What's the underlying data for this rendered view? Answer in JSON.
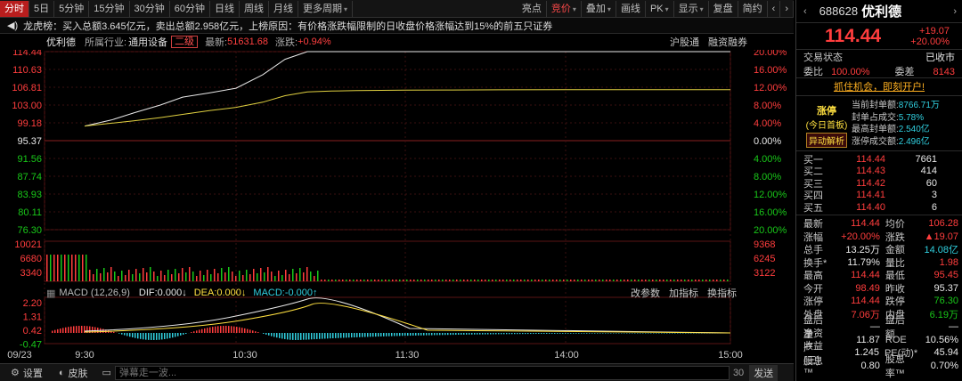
{
  "toolbar": {
    "left_tabs": [
      "分时",
      "5日",
      "5分钟",
      "15分钟",
      "30分钟",
      "60分钟",
      "日线",
      "周线",
      "月线",
      "更多周期"
    ],
    "right_buttons": [
      "亮点",
      "竞价",
      "叠加",
      "画线",
      "PK",
      "显示",
      "复盘",
      "简约"
    ],
    "active_tab": "分时",
    "active_right": "竞价"
  },
  "ticker": {
    "prefix": "龙虎榜：",
    "text": "买入总额3.645亿元，卖出总额2.958亿元，上榜原因：有价格涨跌幅限制的日收盘价格涨幅达到15%的前五只证券"
  },
  "info": {
    "name": "优利德",
    "industry_label": "所属行业:",
    "industry": "通用设备",
    "board": "二级",
    "latest_label": "最新:",
    "latest": "51631.68",
    "change_label": "涨跌:",
    "change": "+0.94%",
    "link1": "沪股通",
    "link2": "融资融券"
  },
  "price_axis": {
    "left": [
      "114.44",
      "110.63",
      "106.81",
      "103.00",
      "99.18",
      "95.37",
      "91.56",
      "87.74",
      "83.93",
      "80.11",
      "76.30"
    ],
    "right": [
      "20.00%",
      "16.00%",
      "12.00%",
      "8.00%",
      "4.00%",
      "0.00%",
      "4.00%",
      "8.00%",
      "12.00%",
      "16.00%",
      "20.00%"
    ]
  },
  "volume_axis": {
    "left": [
      "10021",
      "6680",
      "3340"
    ],
    "right": [
      "9368",
      "6245",
      "3122"
    ]
  },
  "macd": {
    "title": "MACD (12,26,9)",
    "dif": "DIF:0.000",
    "dea": "DEA:0.000",
    "macd": "MACD:-0.000",
    "buttons": [
      "改参数",
      "加指标",
      "换指标"
    ],
    "axis": [
      "2.20",
      "1.31",
      "0.42",
      "-0.47"
    ]
  },
  "time_axis": [
    "09/23",
    "9:30",
    "10:30",
    "11:30",
    "14:00",
    "15:00"
  ],
  "bottom": {
    "settings": "设置",
    "skin": "皮肤",
    "placeholder": "弹幕走一波...",
    "count": "30",
    "send": "发送"
  },
  "quote": {
    "code": "688628",
    "name": "优利德",
    "price": "114.44",
    "change": "+19.07",
    "pct": "+20.00%",
    "status_label": "交易状态",
    "status": "已收市",
    "ratio_label": "委比",
    "ratio": "100.00%",
    "diff_label": "委差",
    "diff": "8143",
    "promo": "抓住机会，即刻开户!",
    "limit_label": "涨停",
    "limit_sub": "(今日首板)",
    "limit_btn": "异动解析",
    "seal": [
      {
        "label": "当前封单额:",
        "value": "8766.71万"
      },
      {
        "label": "封单占成交:",
        "value": "5.78%"
      },
      {
        "label": "最高封单额:",
        "value": "2.540亿"
      },
      {
        "label": "涨停成交额:",
        "value": "2.496亿"
      }
    ],
    "book": [
      {
        "label": "买一",
        "price": "114.44",
        "qty": "7661"
      },
      {
        "label": "买二",
        "price": "114.43",
        "qty": "414"
      },
      {
        "label": "买三",
        "price": "114.42",
        "qty": "60"
      },
      {
        "label": "买四",
        "price": "114.41",
        "qty": "3"
      },
      {
        "label": "买五",
        "price": "114.40",
        "qty": "6"
      }
    ],
    "stats": [
      {
        "k": "最新",
        "v": "114.44",
        "vc": "red",
        "k2": "均价",
        "v2": "106.28",
        "v2c": "red"
      },
      {
        "k": "涨幅",
        "v": "+20.00%",
        "vc": "red",
        "k2": "涨跌",
        "v2": "▲19.07",
        "v2c": "red"
      },
      {
        "k": "总手",
        "v": "13.25万",
        "vc": "white",
        "k2": "金额",
        "v2": "14.08亿",
        "v2c": "cyan"
      },
      {
        "k": "换手*",
        "v": "11.79%",
        "vc": "white",
        "k2": "量比",
        "v2": "1.98",
        "v2c": "red"
      },
      {
        "k": "最高",
        "v": "114.44",
        "vc": "red",
        "k2": "最低",
        "v2": "95.45",
        "v2c": "red"
      },
      {
        "k": "今开",
        "v": "98.49",
        "vc": "red",
        "k2": "昨收",
        "v2": "95.37",
        "v2c": "white"
      },
      {
        "k": "涨停",
        "v": "114.44",
        "vc": "red",
        "k2": "跌停",
        "v2": "76.30",
        "v2c": "green"
      },
      {
        "k": "外盘",
        "v": "7.06万",
        "vc": "red",
        "k2": "内盘",
        "v2": "6.19万",
        "v2c": "green"
      },
      {
        "k": "盘后量",
        "v": "—",
        "vc": "white",
        "k2": "盘后额",
        "v2": "—",
        "v2c": "white"
      },
      {
        "k": "净资产",
        "v": "11.87",
        "vc": "white",
        "k2": "ROE",
        "v2": "10.56%",
        "v2c": "white"
      },
      {
        "k": "收益(三)",
        "v": "1.245",
        "vc": "white",
        "k2": "PE(动)*",
        "v2": "45.94",
        "v2c": "white"
      },
      {
        "k": "股息™",
        "v": "0.80",
        "vc": "white",
        "k2": "股息率™",
        "v2": "0.70%",
        "v2c": "white"
      }
    ]
  },
  "chart_data": {
    "type": "line",
    "prev_close": 95.37,
    "ylim": [
      76.3,
      114.44
    ],
    "x": [
      "9:30",
      "9:40",
      "9:50",
      "10:00",
      "10:10",
      "10:20",
      "10:30",
      "10:40",
      "10:50",
      "11:00",
      "11:10",
      "11:20",
      "11:30",
      "13:10",
      "13:30",
      "14:00",
      "14:30",
      "15:00"
    ],
    "series": [
      {
        "values": [
          98.5,
          99.8,
          101.3,
          103.0,
          104.7,
          105.6,
          106.6,
          109.5,
          112.8,
          114.44,
          114.44,
          114.44,
          114.44,
          114.44,
          114.44,
          114.44,
          114.44,
          114.44
        ]
      },
      {
        "values": [
          98.5,
          99.1,
          99.6,
          100.3,
          101.0,
          101.8,
          102.5,
          103.6,
          105.0,
          105.8,
          106.0,
          106.1,
          106.2,
          106.23,
          106.25,
          106.27,
          106.28,
          106.28
        ]
      }
    ]
  }
}
